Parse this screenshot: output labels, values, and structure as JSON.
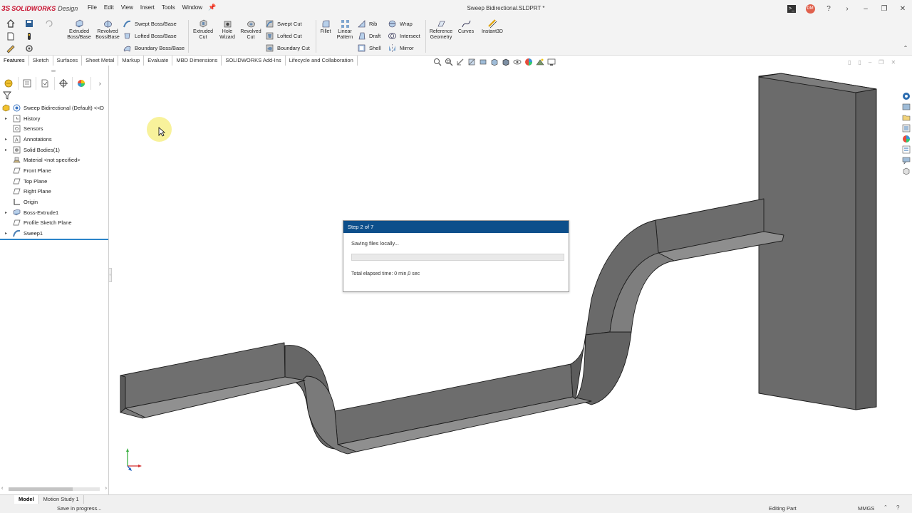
{
  "app": {
    "brand_prefix": "3S",
    "brand": "SOLIDWORKS",
    "brand_suffix": "Design",
    "document_title": "Sweep Bidirectional.SLDPRT *",
    "menus": [
      "File",
      "Edit",
      "View",
      "Insert",
      "Tools",
      "Window"
    ],
    "user_initials": "DM"
  },
  "command_manager": {
    "extruded_boss": "Extruded Boss/Base",
    "revolved_boss": "Revolved Boss/Base",
    "swept_boss": "Swept Boss/Base",
    "lofted_boss": "Lofted Boss/Base",
    "boundary_boss": "Boundary Boss/Base",
    "extruded_cut": "Extruded Cut",
    "hole_wizard": "Hole Wizard",
    "revolved_cut": "Revolved Cut",
    "swept_cut": "Swept Cut",
    "lofted_cut": "Lofted Cut",
    "boundary_cut": "Boundary Cut",
    "fillet": "Fillet",
    "linear_pattern": "Linear Pattern",
    "rib": "Rib",
    "draft": "Draft",
    "shell": "Shell",
    "wrap": "Wrap",
    "intersect": "Intersect",
    "mirror": "Mirror",
    "reference_geometry": "Reference Geometry",
    "curves": "Curves",
    "instant3d": "Instant3D"
  },
  "tabs": [
    "Features",
    "Sketch",
    "Surfaces",
    "Sheet Metal",
    "Markup",
    "Evaluate",
    "MBD Dimensions",
    "SOLIDWORKS Add-Ins",
    "Lifecycle and Collaboration"
  ],
  "active_tab": "Features",
  "feature_tree": {
    "root": "Sweep Bidirectional (Default) <<D",
    "items": [
      {
        "label": "History",
        "expandable": true,
        "icon": "history-icon"
      },
      {
        "label": "Sensors",
        "expandable": false,
        "icon": "sensors-icon"
      },
      {
        "label": "Annotations",
        "expandable": true,
        "icon": "annotations-icon"
      },
      {
        "label": "Solid Bodies(1)",
        "expandable": true,
        "icon": "solid-bodies-icon"
      },
      {
        "label": "Material <not specified>",
        "expandable": false,
        "icon": "material-icon"
      },
      {
        "label": "Front Plane",
        "expandable": false,
        "icon": "plane-icon"
      },
      {
        "label": "Top Plane",
        "expandable": false,
        "icon": "plane-icon"
      },
      {
        "label": "Right Plane",
        "expandable": false,
        "icon": "plane-icon"
      },
      {
        "label": "Origin",
        "expandable": false,
        "icon": "origin-icon"
      },
      {
        "label": "Boss-Extrude1",
        "expandable": true,
        "icon": "extrude-icon"
      },
      {
        "label": "Profile Sketch Plane",
        "expandable": false,
        "icon": "plane-icon"
      },
      {
        "label": "Sweep1",
        "expandable": true,
        "icon": "sweep-icon"
      }
    ]
  },
  "dialog": {
    "title": "Step 2 of 7",
    "message": "Saving files locally...",
    "progress": 0,
    "elapsed": "Total elapsed time: 0 min,0 sec"
  },
  "bottom_tabs": [
    "Model",
    "Motion Study 1"
  ],
  "status": {
    "left": "Save in progress...",
    "mode": "Editing Part",
    "units": "MMGS"
  },
  "colors": {
    "model_face": "#6f6f6f",
    "model_face_light": "#8a8a8a",
    "model_edge": "#1c1c1c",
    "dialog_title_bar": "#0d4f8b",
    "selection_line": "#2b84c9"
  }
}
